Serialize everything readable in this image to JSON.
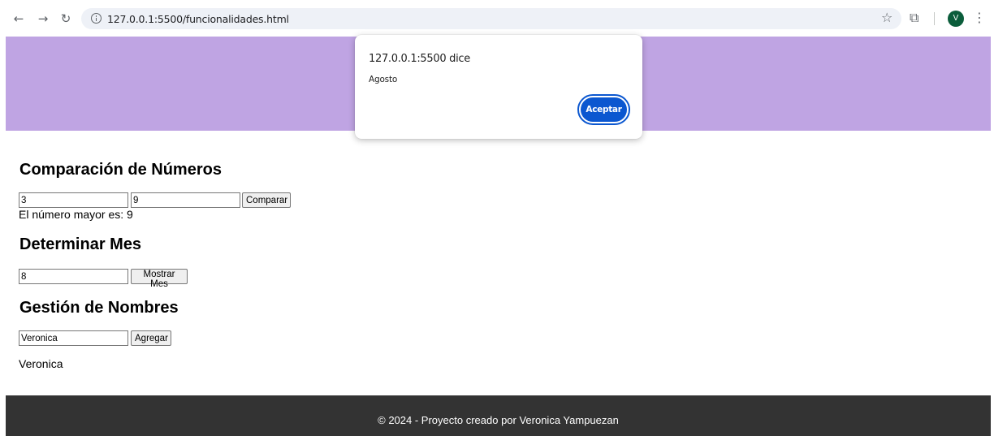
{
  "browser": {
    "url": "127.0.0.1:5500/funcionalidades.html",
    "avatar_letter": "V",
    "icons": {
      "back": "back-arrow-icon",
      "forward": "forward-arrow-icon",
      "reload": "reload-icon",
      "site_info": "info-icon",
      "bookmark": "star-icon",
      "extensions": "puzzle-icon",
      "menu": "kebab-menu-icon"
    }
  },
  "colors": {
    "banner": "#bfa4e3",
    "footer": "#333333",
    "dialog_button": "#0b57d0",
    "avatar": "#0b5d3b"
  },
  "comparison": {
    "title": "Comparación de Números",
    "input1_value": "3",
    "input2_value": "9",
    "button_label": "Comparar",
    "result": "El número mayor es: 9"
  },
  "month": {
    "title": "Determinar Mes",
    "input_value": "8",
    "button_label": "Mostrar Mes"
  },
  "names": {
    "title": "Gestión de Nombres",
    "input_value": "Veronica",
    "button_label": "Agregar",
    "list": [
      "Veronica"
    ]
  },
  "footer": {
    "text": "© 2024 - Proyecto creado por Veronica Yampuezan"
  },
  "dialog": {
    "title": "127.0.0.1:5500 dice",
    "message": "Agosto",
    "button_label": "Aceptar"
  }
}
